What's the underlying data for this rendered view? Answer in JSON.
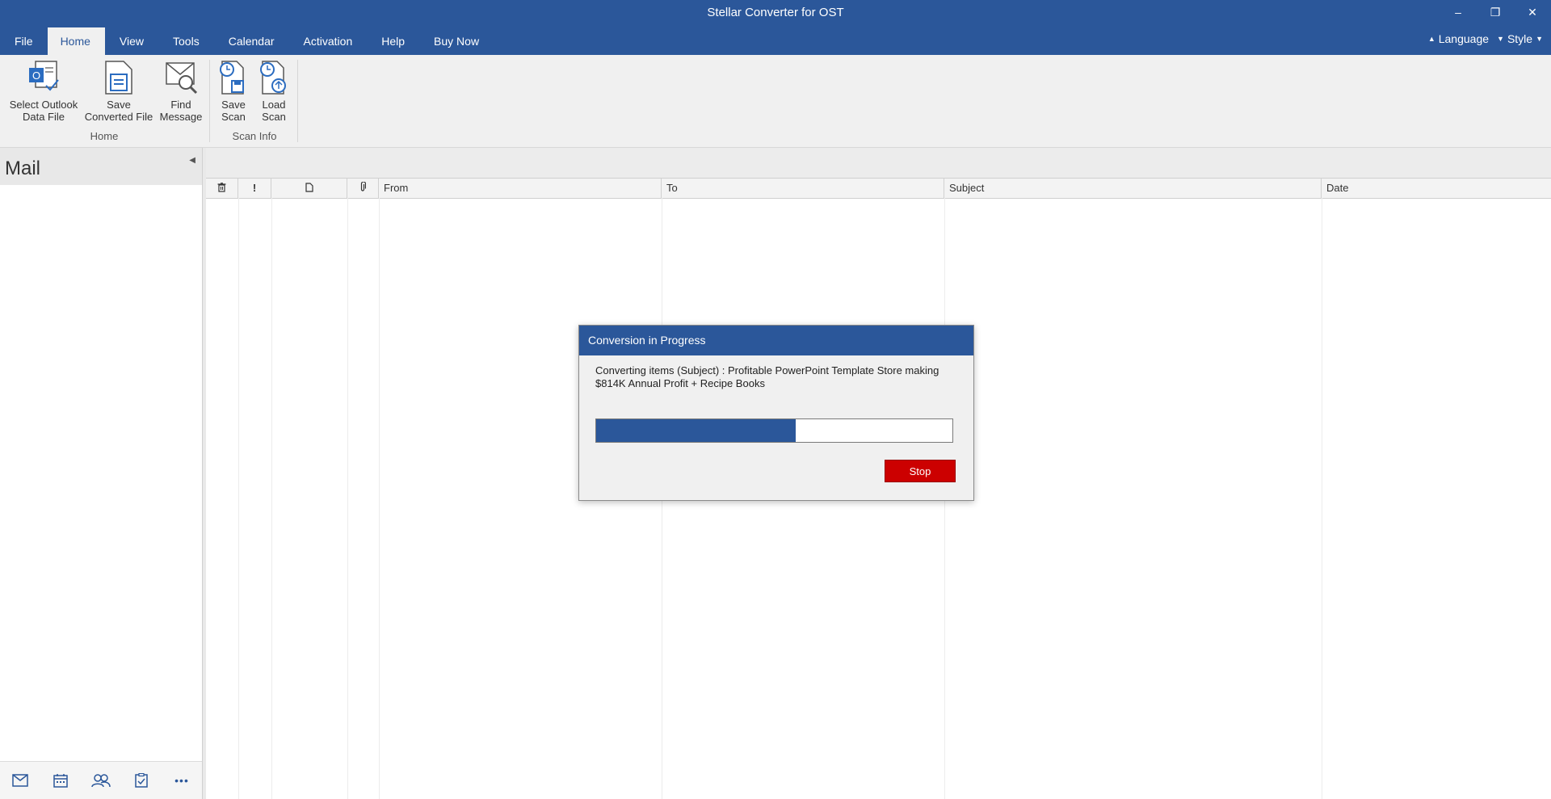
{
  "window": {
    "title": "Stellar Converter for OST",
    "minimize_glyph": "–",
    "restore_glyph": "❐",
    "close_glyph": "✕"
  },
  "tabs": [
    {
      "label": "File"
    },
    {
      "label": "Home",
      "active": true
    },
    {
      "label": "View"
    },
    {
      "label": "Tools"
    },
    {
      "label": "Calendar"
    },
    {
      "label": "Activation"
    },
    {
      "label": "Help"
    },
    {
      "label": "Buy Now"
    }
  ],
  "right_menus": {
    "language": "Language",
    "style": "Style"
  },
  "ribbon": {
    "groups": [
      {
        "label": "Home",
        "buttons": [
          {
            "line1": "Select Outlook",
            "line2": "Data File",
            "icon": "outlook-file-icon"
          },
          {
            "line1": "Save",
            "line2": "Converted File",
            "icon": "save-document-icon"
          },
          {
            "line1": "Find",
            "line2": "Message",
            "icon": "find-message-icon"
          }
        ]
      },
      {
        "label": "Scan Info",
        "buttons": [
          {
            "line1": "Save",
            "line2": "Scan",
            "icon": "save-scan-icon"
          },
          {
            "line1": "Load",
            "line2": "Scan",
            "icon": "load-scan-icon"
          }
        ]
      }
    ]
  },
  "left_pane": {
    "title": "Mail",
    "bottom_nav": [
      "mail-icon",
      "calendar-icon",
      "contacts-icon",
      "tasks-icon",
      "more-icon"
    ],
    "more_glyph": "•••"
  },
  "grid": {
    "columns": [
      {
        "label": "",
        "icon": "trash-icon"
      },
      {
        "label": "!",
        "icon": "importance-icon"
      },
      {
        "label": "",
        "icon": "document-icon"
      },
      {
        "label": "",
        "icon": "attachment-icon"
      },
      {
        "label": "From"
      },
      {
        "label": "To"
      },
      {
        "label": "Subject"
      },
      {
        "label": "Date"
      }
    ]
  },
  "dialog": {
    "title": "Conversion in Progress",
    "message": "Converting items (Subject) : Profitable PowerPoint Template Store making $814K Annual Profit + Recipe Books",
    "progress_fraction": 0.56,
    "stop_label": "Stop"
  },
  "colors": {
    "accent": "#2b579a",
    "stop": "#cc0000"
  }
}
